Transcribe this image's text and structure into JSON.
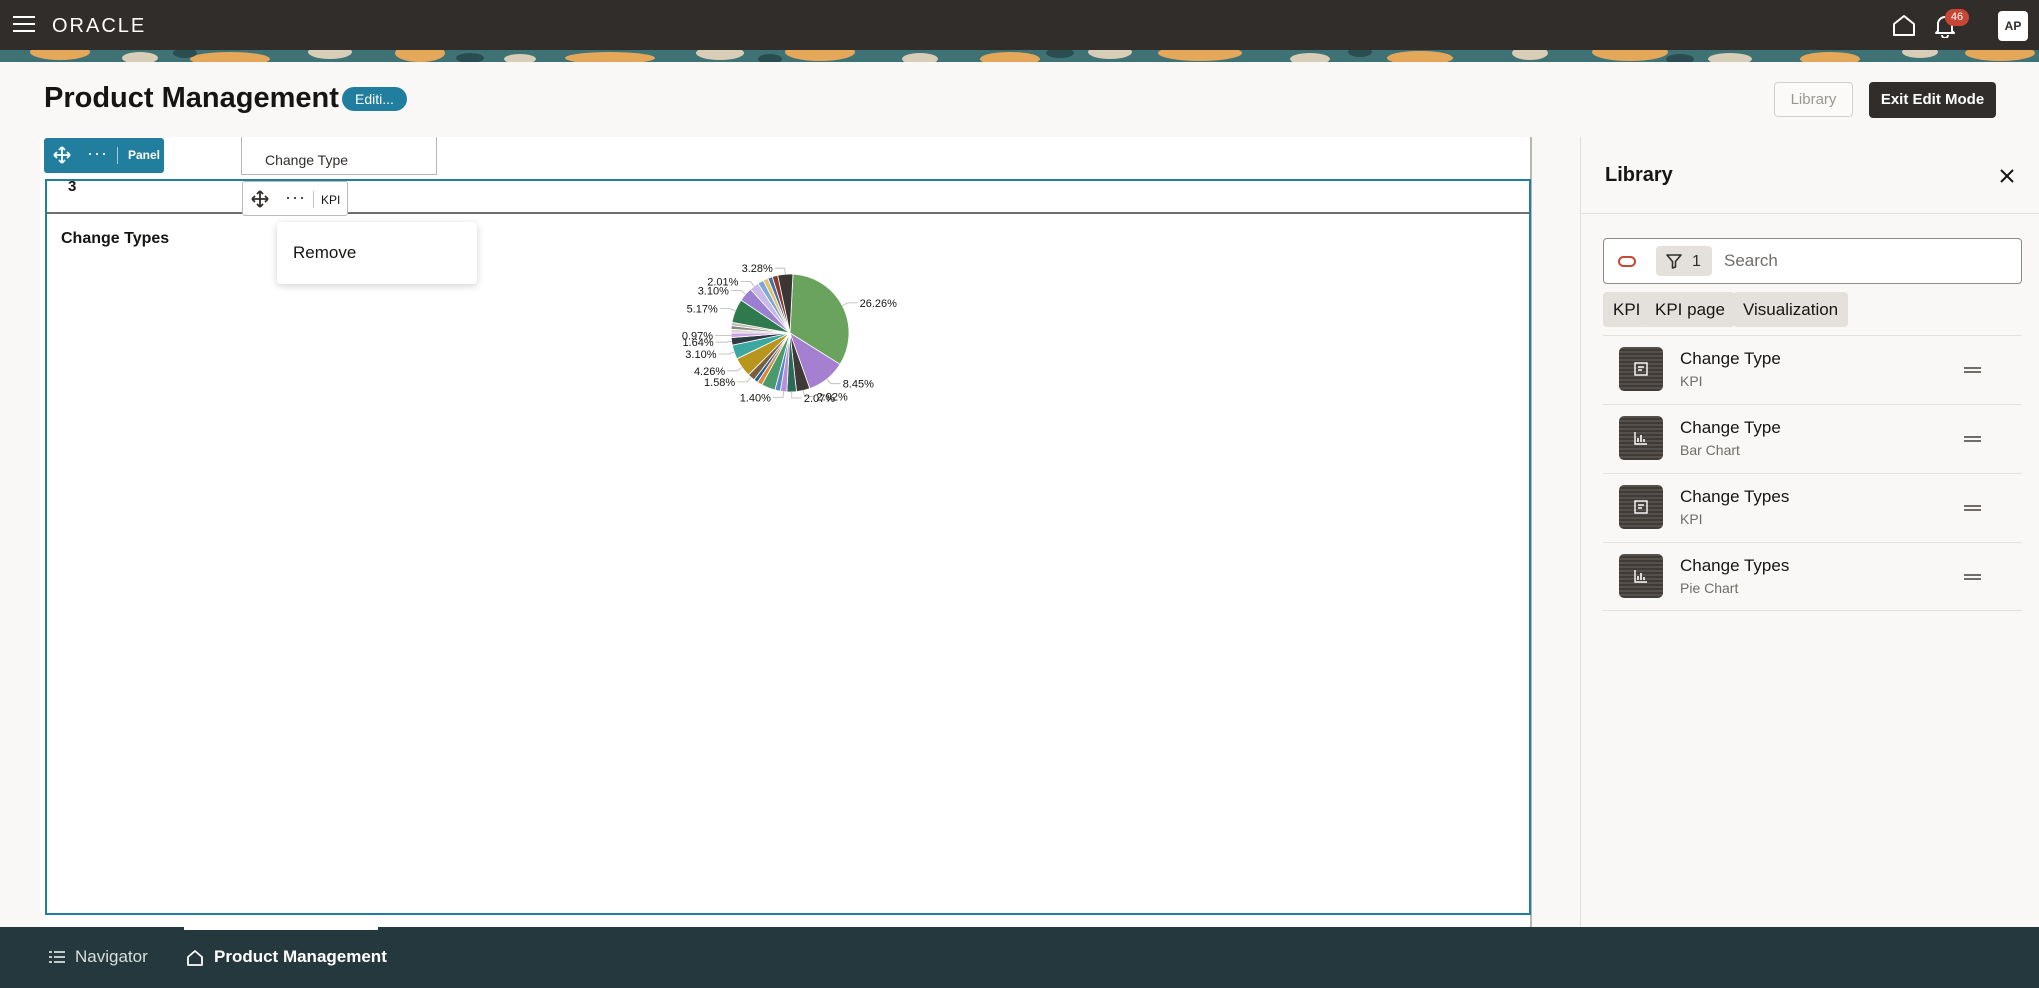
{
  "app": {
    "brand": "ORACLE",
    "notification_count": "46",
    "user_initials": "AP"
  },
  "header": {
    "title": "Product Management",
    "mode_badge": "Editi...",
    "library_button": "Library",
    "exit_button": "Exit Edit Mode"
  },
  "canvas": {
    "panel_toolbar_label": "Panel",
    "kpi_header_label": "Change Type",
    "kpi_value": "3",
    "kpi_toolbar_label": "KPI",
    "context_menu": {
      "remove": "Remove"
    },
    "chart_title": "Change Types"
  },
  "chart_data": {
    "type": "pie",
    "title": "Change Types",
    "slices": [
      {
        "value": 26.26,
        "label": "26.26%",
        "color": "#6aa35d"
      },
      {
        "value": 8.45,
        "label": "8.45%",
        "color": "#a57fd0"
      },
      {
        "value": 2.92,
        "label": "2.92%",
        "color": "#3f3a38"
      },
      {
        "value": 2.07,
        "label": "2.07%",
        "color": "#2d6a55"
      },
      {
        "value": 1.4,
        "label": "1.40%",
        "color": "#b58ede"
      },
      {
        "value": 1.2,
        "label": "",
        "color": "#5b87c7"
      },
      {
        "value": 3.0,
        "label": "",
        "color": "#4c9a6a"
      },
      {
        "value": 1.1,
        "label": "",
        "color": "#d98a3b"
      },
      {
        "value": 0.9,
        "label": "",
        "color": "#2f5d9b"
      },
      {
        "value": 1.58,
        "label": "1.58%",
        "color": "#7b5e3b"
      },
      {
        "value": 4.26,
        "label": "4.26%",
        "color": "#b8961e"
      },
      {
        "value": 3.1,
        "label": "3.10%",
        "color": "#3aa8a0"
      },
      {
        "value": 1.64,
        "label": "1.64%",
        "color": "#2f3b43"
      },
      {
        "value": 0.97,
        "label": "0.97%",
        "color": "#c9a3e3"
      },
      {
        "value": 0.8,
        "label": "",
        "color": "#d9d6d2"
      },
      {
        "value": 0.8,
        "label": "",
        "color": "#8c8984"
      },
      {
        "value": 0.7,
        "label": "",
        "color": "#bfbcb7"
      },
      {
        "value": 5.17,
        "label": "5.17%",
        "color": "#2f7a4c"
      },
      {
        "value": 3.1,
        "label": "3.10%",
        "color": "#9b7fd1"
      },
      {
        "value": 2.01,
        "label": "2.01%",
        "color": "#c8b9e8"
      },
      {
        "value": 1.3,
        "label": "",
        "color": "#7da6d9"
      },
      {
        "value": 1.1,
        "label": "",
        "color": "#e2c36b"
      },
      {
        "value": 1.0,
        "label": "",
        "color": "#4b6ea8"
      },
      {
        "value": 1.2,
        "label": "",
        "color": "#8a3b2e"
      },
      {
        "value": 3.28,
        "label": "3.28%",
        "color": "#3b3634"
      }
    ]
  },
  "library": {
    "title": "Library",
    "filter_count": "1",
    "search_placeholder": "Search",
    "chips": [
      "KPI",
      "KPI page",
      "Visualization"
    ],
    "items": [
      {
        "name": "Change Type",
        "type": "KPI"
      },
      {
        "name": "Change Type",
        "type": "Bar Chart"
      },
      {
        "name": "Change Types",
        "type": "KPI"
      },
      {
        "name": "Change Types",
        "type": "Pie Chart"
      }
    ]
  },
  "bottom_nav": {
    "navigator": "Navigator",
    "current": "Product Management"
  }
}
